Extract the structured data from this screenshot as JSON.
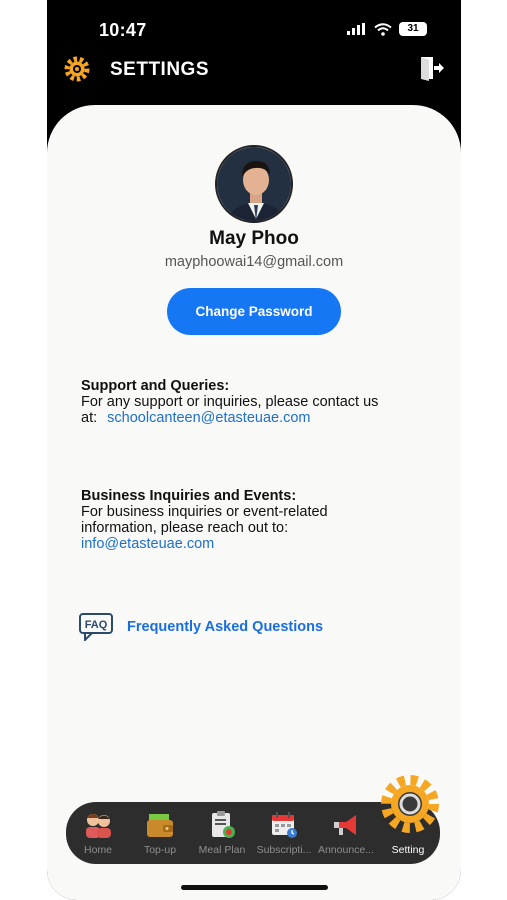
{
  "status_bar": {
    "time": "10:47",
    "battery": "31"
  },
  "header": {
    "title": "SETTINGS"
  },
  "profile": {
    "name": "May Phoo",
    "email": "mayphoowai14@gmail.com"
  },
  "actions": {
    "change_password": "Change Password"
  },
  "support": {
    "title": "Support and Queries:",
    "line1": "For any support or inquiries, please contact us",
    "line2_prefix": "at:",
    "email": "schoolcanteen@etasteuae.com"
  },
  "business": {
    "title": "Business Inquiries and Events:",
    "line1": "For business inquiries or event-related",
    "line2": "information, please reach out to:",
    "email": "info@etasteuae.com"
  },
  "faq": {
    "icon_text": "FAQ",
    "label": "Frequently Asked Questions"
  },
  "nav": {
    "items": [
      {
        "label": "Home",
        "icon": "family-icon"
      },
      {
        "label": "Top-up",
        "icon": "wallet-icon"
      },
      {
        "label": "Meal Plan",
        "icon": "meal-plan-icon"
      },
      {
        "label": "Subscripti...",
        "icon": "calendar-icon"
      },
      {
        "label": "Announce...",
        "icon": "megaphone-icon"
      },
      {
        "label": "Setting",
        "icon": "gear-icon"
      }
    ],
    "active": "Setting"
  },
  "colors": {
    "accent": "#1677f5",
    "link": "#1e6fd1",
    "gear": "#f5a623",
    "header_bg": "#000000"
  }
}
